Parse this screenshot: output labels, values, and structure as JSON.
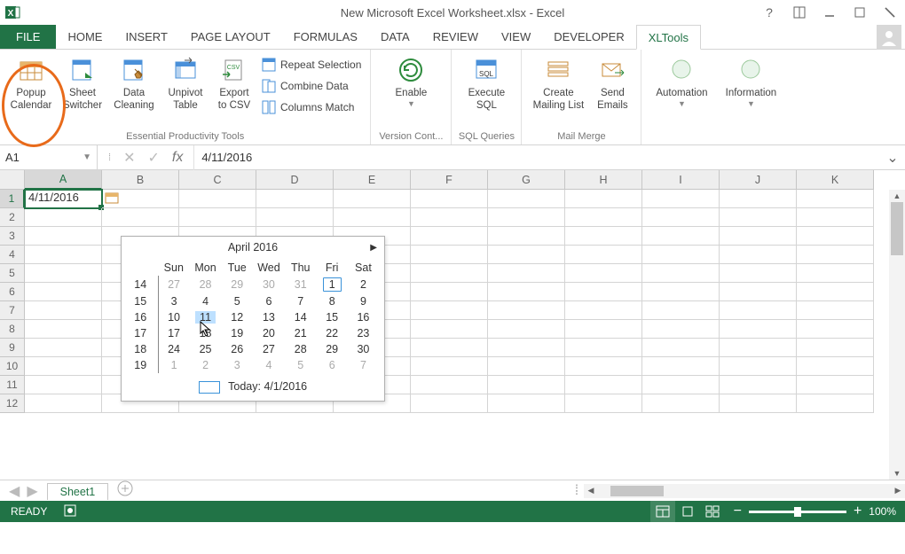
{
  "window": {
    "title": "New Microsoft Excel Worksheet.xlsx - Excel"
  },
  "ribbon": {
    "file_label": "FILE",
    "tabs": [
      "HOME",
      "INSERT",
      "PAGE LAYOUT",
      "FORMULAS",
      "DATA",
      "REVIEW",
      "VIEW",
      "DEVELOPER",
      "XLTools"
    ],
    "active_tab": "XLTools",
    "groups": {
      "essential": {
        "name": "Essential Productivity Tools",
        "popup_calendar": "Popup\nCalendar",
        "sheet_switcher": "Sheet\nSwitcher",
        "data_cleaning": "Data\nCleaning",
        "unpivot_table": "Unpivot\nTable",
        "export_csv": "Export\nto CSV",
        "repeat_selection": "Repeat Selection",
        "combine_data": "Combine Data",
        "columns_match": "Columns Match"
      },
      "version": {
        "name": "Version Cont...",
        "enable": "Enable"
      },
      "sql": {
        "name": "SQL Queries",
        "execute": "Execute\nSQL"
      },
      "mailmerge": {
        "name": "Mail Merge",
        "create_list": "Create\nMailing List",
        "send_emails": "Send\nEmails"
      },
      "automation": {
        "label": "Automation"
      },
      "information": {
        "label": "Information"
      }
    }
  },
  "formula_bar": {
    "name_box": "A1",
    "fx_label": "fx",
    "value": "4/11/2016"
  },
  "grid": {
    "columns": [
      "A",
      "B",
      "C",
      "D",
      "E",
      "F",
      "G",
      "H",
      "I",
      "J",
      "K"
    ],
    "rows": [
      1,
      2,
      3,
      4,
      5,
      6,
      7,
      8,
      9,
      10,
      11,
      12
    ],
    "selected_cell": "A1",
    "cell_a1": "4/11/2016"
  },
  "calendar": {
    "header": "April 2016",
    "dow": [
      "Sun",
      "Mon",
      "Tue",
      "Wed",
      "Thu",
      "Fri",
      "Sat"
    ],
    "week_nums": [
      14,
      15,
      16,
      17,
      18,
      19
    ],
    "rows": [
      [
        {
          "d": 27,
          "other": true
        },
        {
          "d": 28,
          "other": true
        },
        {
          "d": 29,
          "other": true
        },
        {
          "d": 30,
          "other": true
        },
        {
          "d": 31,
          "other": true
        },
        {
          "d": 1,
          "today": true
        },
        {
          "d": 2
        }
      ],
      [
        {
          "d": 3
        },
        {
          "d": 4
        },
        {
          "d": 5
        },
        {
          "d": 6
        },
        {
          "d": 7
        },
        {
          "d": 8
        },
        {
          "d": 9
        }
      ],
      [
        {
          "d": 10
        },
        {
          "d": 11,
          "selected": true
        },
        {
          "d": 12
        },
        {
          "d": 13
        },
        {
          "d": 14
        },
        {
          "d": 15
        },
        {
          "d": 16
        }
      ],
      [
        {
          "d": 17
        },
        {
          "d": 18
        },
        {
          "d": 19
        },
        {
          "d": 20
        },
        {
          "d": 21
        },
        {
          "d": 22
        },
        {
          "d": 23
        }
      ],
      [
        {
          "d": 24
        },
        {
          "d": 25
        },
        {
          "d": 26
        },
        {
          "d": 27
        },
        {
          "d": 28
        },
        {
          "d": 29
        },
        {
          "d": 30
        }
      ],
      [
        {
          "d": 1,
          "other": true
        },
        {
          "d": 2,
          "other": true
        },
        {
          "d": 3,
          "other": true
        },
        {
          "d": 4,
          "other": true
        },
        {
          "d": 5,
          "other": true
        },
        {
          "d": 6,
          "other": true
        },
        {
          "d": 7,
          "other": true
        }
      ]
    ],
    "today_label": "Today: 4/1/2016"
  },
  "sheets": {
    "active": "Sheet1"
  },
  "status": {
    "ready": "READY",
    "zoom": "100%"
  },
  "colors": {
    "excel_green": "#217346",
    "highlight_orange": "#e86a1a"
  }
}
